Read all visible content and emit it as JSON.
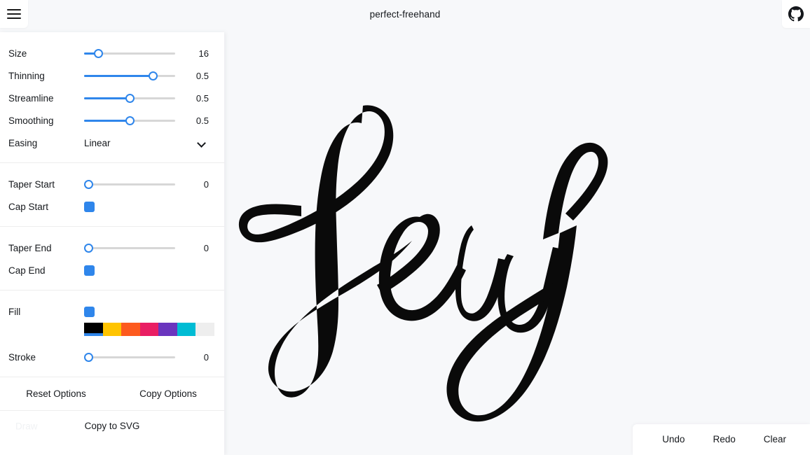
{
  "header": {
    "title": "perfect-freehand",
    "menu_icon": "hamburger-menu-icon",
    "github_icon": "github-icon"
  },
  "panel": {
    "sections": [
      {
        "name": "stroke-options",
        "rows": [
          {
            "label": "Size",
            "type": "slider",
            "value": "16",
            "fill_pct": 15
          },
          {
            "label": "Thinning",
            "type": "slider",
            "value": "0.5",
            "fill_pct": 75
          },
          {
            "label": "Streamline",
            "type": "slider",
            "value": "0.5",
            "fill_pct": 50
          },
          {
            "label": "Smoothing",
            "type": "slider",
            "value": "0.5",
            "fill_pct": 50
          },
          {
            "label": "Easing",
            "type": "select",
            "value": "Linear"
          }
        ]
      },
      {
        "name": "start-options",
        "rows": [
          {
            "label": "Taper Start",
            "type": "slider",
            "value": "0",
            "fill_pct": 0
          },
          {
            "label": "Cap Start",
            "type": "checkbox",
            "checked": true
          }
        ]
      },
      {
        "name": "end-options",
        "rows": [
          {
            "label": "Taper End",
            "type": "slider",
            "value": "0",
            "fill_pct": 0
          },
          {
            "label": "Cap End",
            "type": "checkbox",
            "checked": true
          }
        ]
      },
      {
        "name": "appearance-options",
        "rows": [
          {
            "label": "Fill",
            "type": "swatch"
          },
          {
            "label": "Stroke",
            "type": "slider",
            "value": "0",
            "fill_pct": 0
          }
        ]
      }
    ],
    "palette": [
      {
        "name": "black",
        "color": "#000000",
        "selected": true
      },
      {
        "name": "yellow",
        "color": "#ffc400",
        "selected": false
      },
      {
        "name": "orange",
        "color": "#fd5a1e",
        "selected": false
      },
      {
        "name": "pink",
        "color": "#e91e63",
        "selected": false
      },
      {
        "name": "purple",
        "color": "#6a35be",
        "selected": false
      },
      {
        "name": "cyan",
        "color": "#00bcd4",
        "selected": false
      },
      {
        "name": "white",
        "color": "#eeeeee",
        "selected": false
      }
    ],
    "actions": {
      "reset_label": "Reset Options",
      "copy_label": "Copy Options"
    },
    "bottom": {
      "draw_label": "Draw",
      "copy_svg_label": "Copy to SVG"
    }
  },
  "toolbar": {
    "undo_label": "Undo",
    "redo_label": "Redo",
    "clear_label": "Clear"
  },
  "canvas": {
    "drawing_name": "hey-handwriting-stroke",
    "ink_color": "#0a0a0a",
    "background_color": "#f7f8fa"
  },
  "accent_color": "#2f86eb"
}
